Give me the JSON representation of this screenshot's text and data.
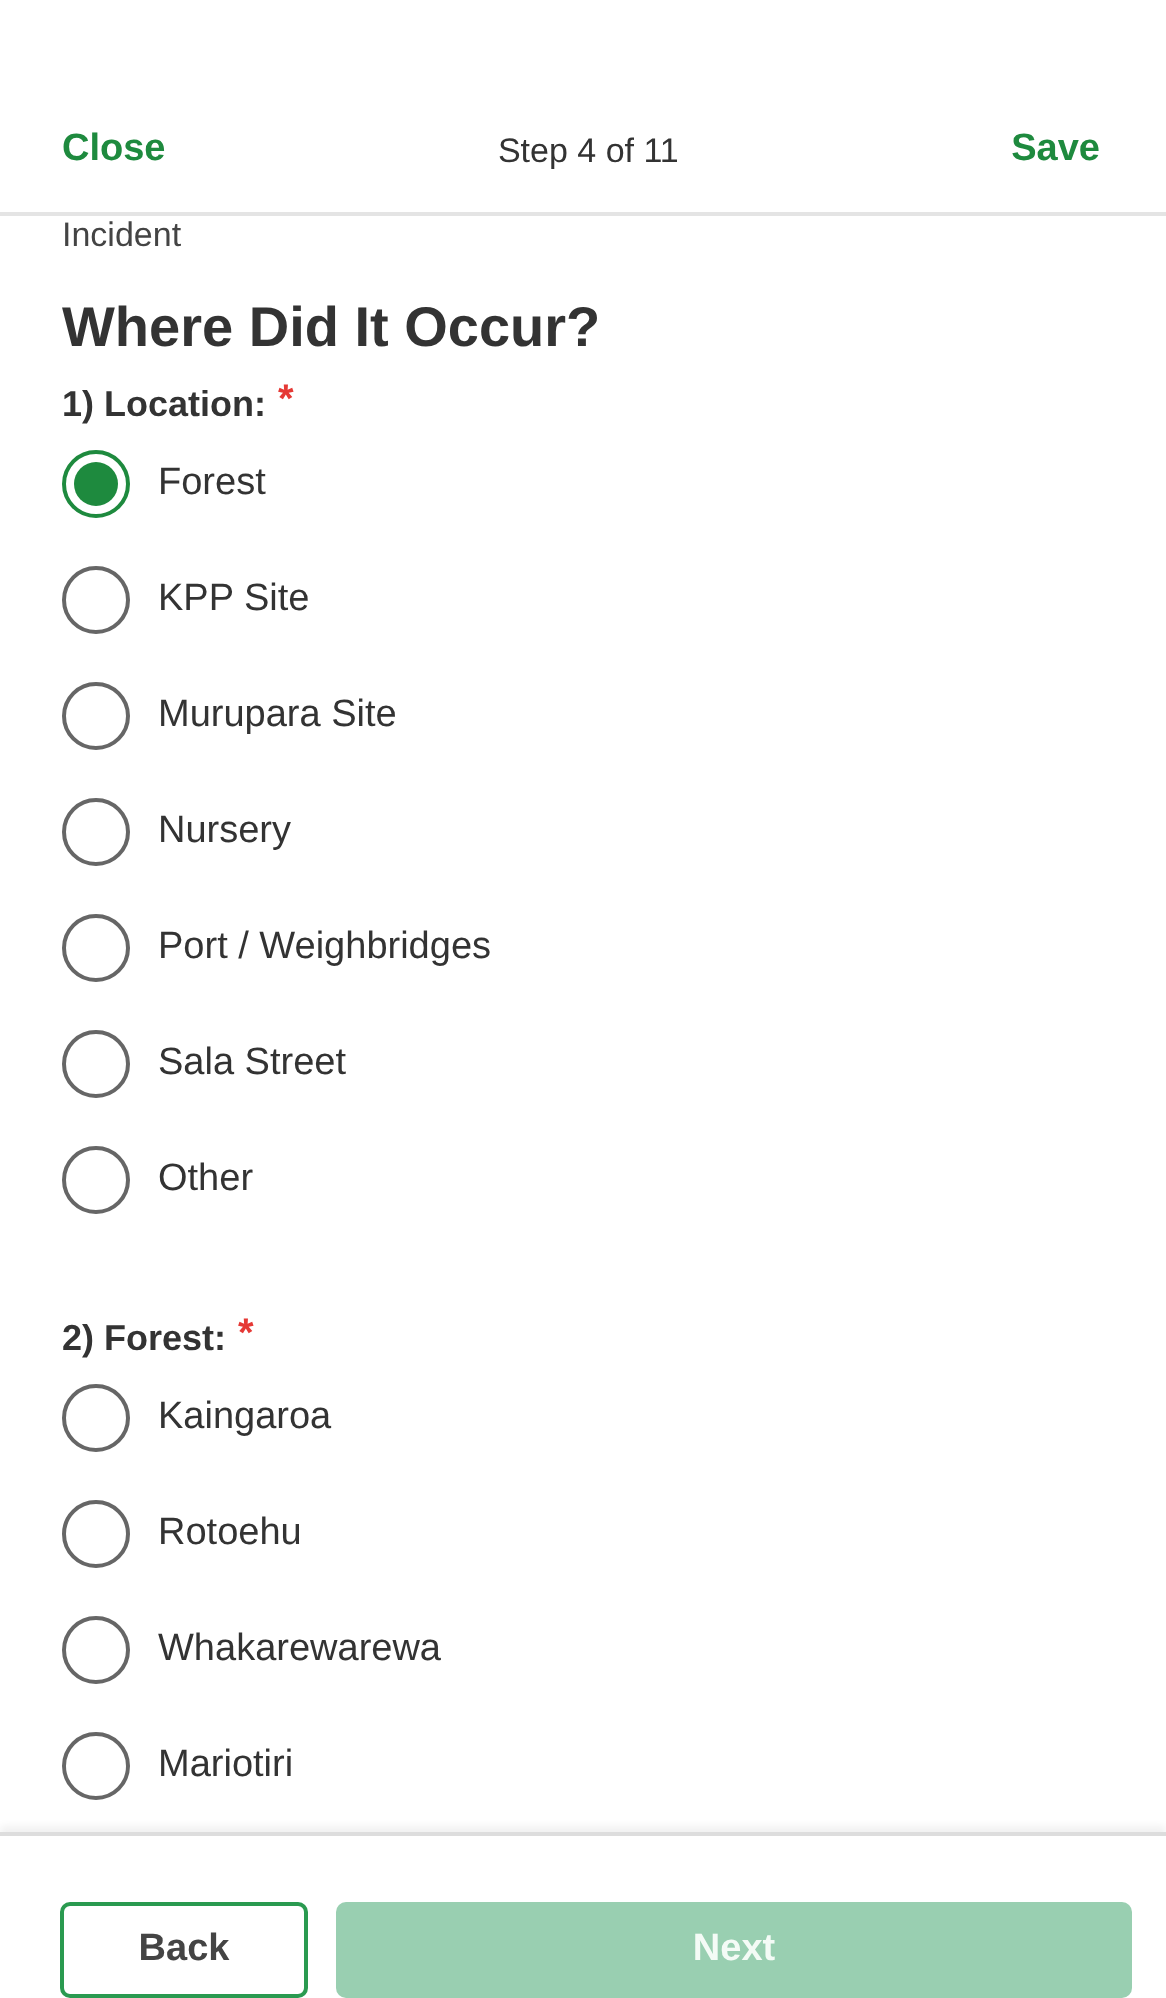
{
  "header": {
    "close": "Close",
    "step": "Step 4 of 11",
    "save": "Save"
  },
  "section_title": "Incident",
  "heading": "Where Did It Occur?",
  "questions": [
    {
      "label": "1) Location:",
      "required_mark": "*",
      "options": [
        {
          "label": "Forest",
          "selected": true
        },
        {
          "label": "KPP Site",
          "selected": false
        },
        {
          "label": "Murupara Site",
          "selected": false
        },
        {
          "label": "Nursery",
          "selected": false
        },
        {
          "label": "Port / Weighbridges",
          "selected": false
        },
        {
          "label": "Sala Street",
          "selected": false
        },
        {
          "label": "Other",
          "selected": false
        }
      ]
    },
    {
      "label": "2) Forest:",
      "required_mark": "*",
      "options": [
        {
          "label": "Kaingaroa",
          "selected": false
        },
        {
          "label": "Rotoehu",
          "selected": false
        },
        {
          "label": "Whakarewarewa",
          "selected": false
        },
        {
          "label": "Mariotiri",
          "selected": false
        }
      ]
    }
  ],
  "footer": {
    "back": "Back",
    "next": {
      "label": "Next",
      "disabled": true
    }
  }
}
